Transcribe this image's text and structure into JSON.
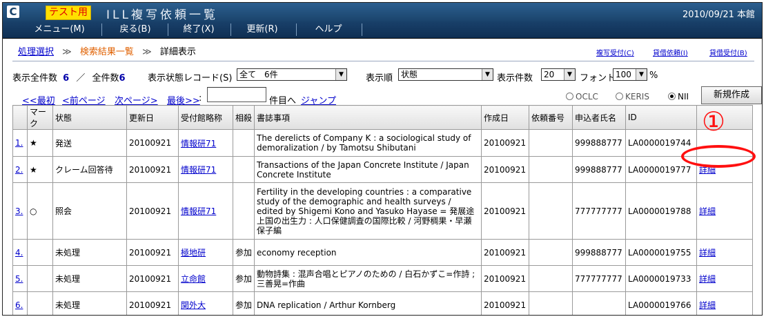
{
  "titlebar": {
    "logo": "C",
    "badge": "テスト用",
    "title": "ILL複写依頼一覧",
    "date": "2010/09/21 本館"
  },
  "menu": [
    "メニュー(M)",
    "戻る(B)",
    "終了(X)",
    "更新(R)",
    "ヘルプ"
  ],
  "breadcrumb": {
    "item1": "処理選択",
    "item2": "検索結果一覧",
    "item3": "詳細表示",
    "separator": "≫"
  },
  "toplinks": [
    "複写受付(C)",
    "貸借依頼(I)",
    "貸借受付(B)"
  ],
  "counts": {
    "shown_label": "表示全件数",
    "shown_value": "6",
    "slash": "／",
    "total_label": "全件数",
    "total_value": "6",
    "status_label": "表示状態レコード(S)",
    "status_value": "全て　6件",
    "order_label": "表示順",
    "order_value": "状態",
    "per_page_label": "表示件数",
    "per_page_value": "20",
    "font_label": "フォント",
    "font_value": "100",
    "font_unit": "%"
  },
  "nav": {
    "first": "<<最初",
    "prev": "<前ページ",
    "next": "次ページ>",
    "last": "最後>>",
    "colon": ":",
    "page_input_value": "",
    "to_item": "件目へ",
    "jump": "ジャンプ",
    "radios": [
      {
        "label": "OCLC",
        "checked": false
      },
      {
        "label": "KERIS",
        "checked": false
      },
      {
        "label": "NII",
        "checked": true
      }
    ],
    "new_button": "新規作成"
  },
  "table": {
    "headers": [
      "",
      "マーク",
      "状態",
      "更新日",
      "受付館略称",
      "相殺",
      "書誌事項",
      "作成日",
      "依頼番号",
      "申込者氏名",
      "ID",
      ""
    ],
    "rows": [
      {
        "no": "1.",
        "mark": "★",
        "status": "発送",
        "updated": "20100921",
        "lib": "情報研71",
        "offset": "",
        "title": "The derelicts of Company K : a sociological study of demoralization / by Tamotsu Shibutani",
        "created": "20100921",
        "req_no": "",
        "applicant": "999888777",
        "id": "LA0000019744",
        "detail": ""
      },
      {
        "no": "2.",
        "mark": "★",
        "status": "クレーム回答待",
        "updated": "20100921",
        "lib": "情報研71",
        "offset": "",
        "title": "Transactions of the Japan Concrete Institute / Japan Concrete Institute",
        "created": "20100921",
        "req_no": "",
        "applicant": "999888777",
        "id": "LA0000019777",
        "detail": "詳細"
      },
      {
        "no": "3.",
        "mark": "○",
        "status": "照会",
        "updated": "20100921",
        "lib": "情報研71",
        "offset": "",
        "title": "Fertility in the developing countries : a comparative study of the demographic and health surveys / edited by Shigemi Kono and Yasuko Hayase = 発展途上国の出生力 : 人口保健調査の国際比較 / 河野稠果・早瀬保子編",
        "created": "20100921",
        "req_no": "",
        "applicant": "777777777",
        "id": "LA0000019788",
        "detail": "詳細"
      },
      {
        "no": "4.",
        "mark": "",
        "status": "未処理",
        "updated": "20100921",
        "lib": "極地研",
        "offset": "参加",
        "title": "economy reception",
        "created": "20100921",
        "req_no": "",
        "applicant": "999888777",
        "id": "LA0000019755",
        "detail": "詳細"
      },
      {
        "no": "5.",
        "mark": "",
        "status": "未処理",
        "updated": "20100921",
        "lib": "立命館",
        "offset": "参加",
        "title": "動物詩集 : 混声合唱とピアノのための / 白石かずこ=作詩 ; 三善晃=作曲",
        "created": "20100921",
        "req_no": "",
        "applicant": "777777777",
        "id": "LA0000019733",
        "detail": "詳細"
      },
      {
        "no": "6.",
        "mark": "",
        "status": "未処理",
        "updated": "20100921",
        "lib": "関外大",
        "offset": "参加",
        "title": "DNA replication / Arthur Kornberg",
        "created": "20100921",
        "req_no": "",
        "applicant": "",
        "id": "LA0000019766",
        "detail": "詳細"
      }
    ]
  },
  "annotation": {
    "number": "①",
    "color": "#ff1010"
  }
}
